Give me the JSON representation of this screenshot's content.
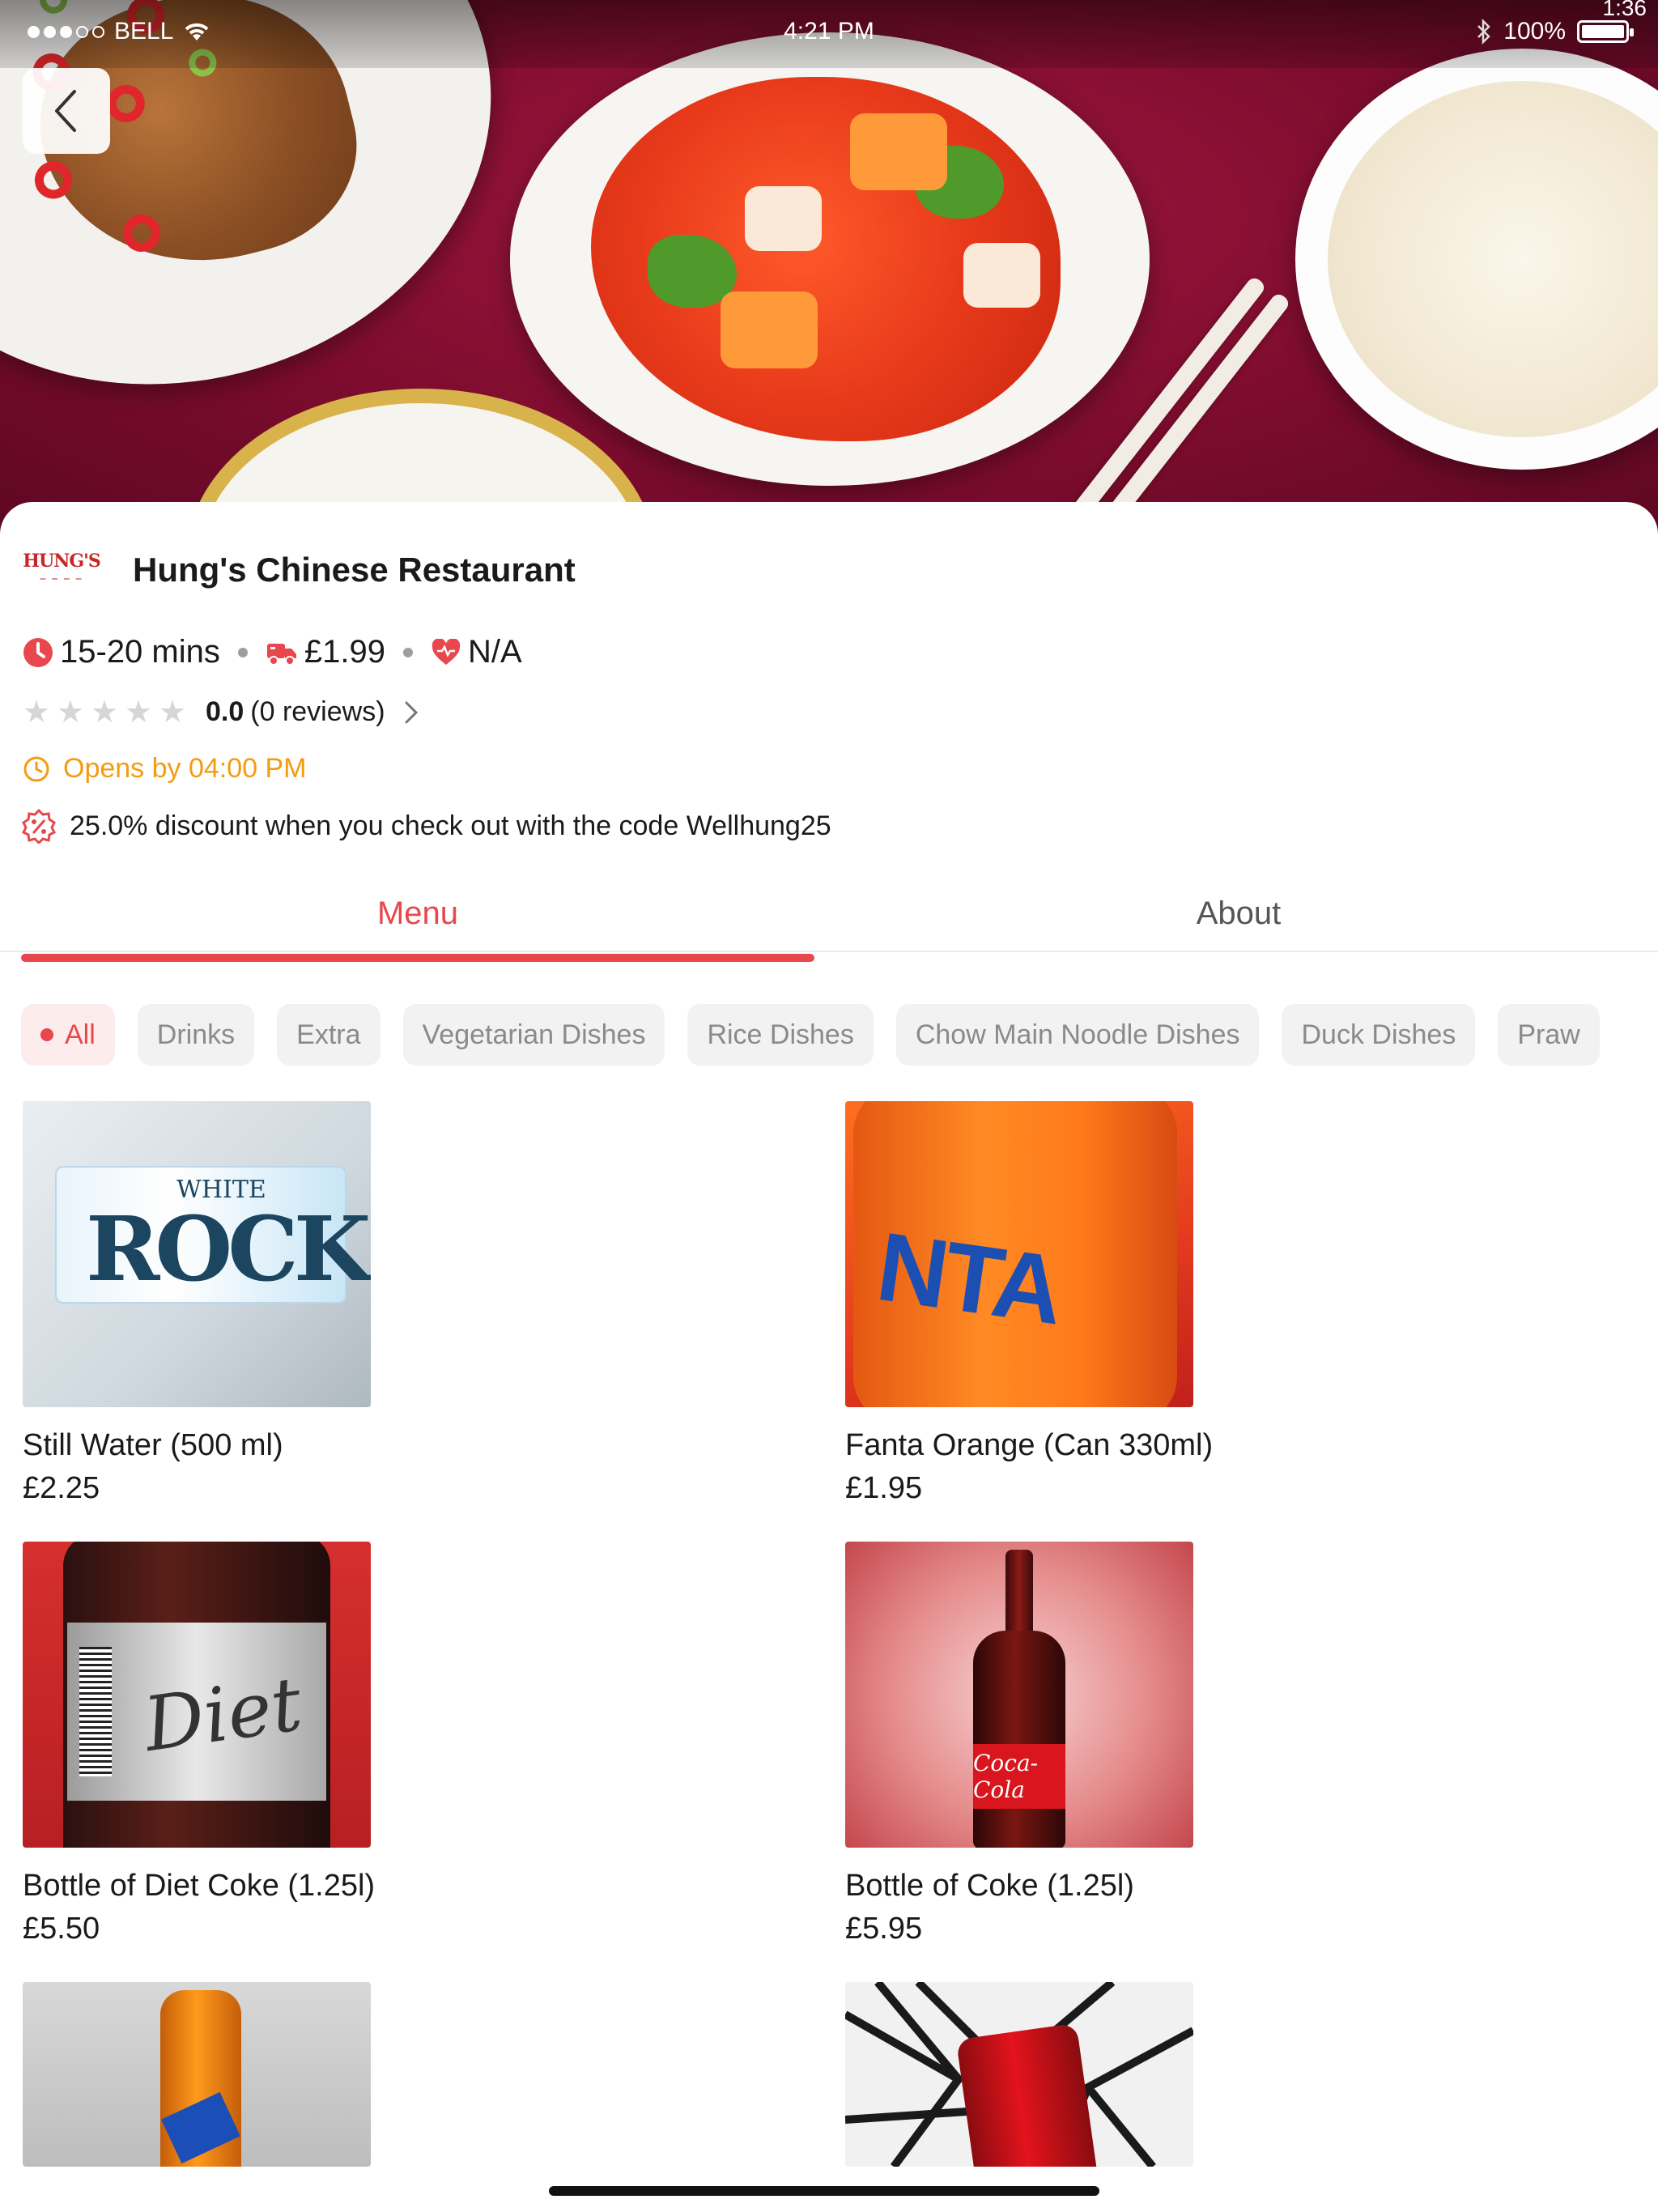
{
  "status_bar": {
    "carrier": "BELL",
    "time": "4:21 PM",
    "battery": "100%",
    "corner_time": "1:36"
  },
  "restaurant": {
    "logo_text": "HUNG'S",
    "name": "Hung's Chinese Restaurant",
    "delivery_time": "15-20 mins",
    "delivery_fee": "£1.99",
    "hygiene": "N/A",
    "rating_value": "0.0",
    "rating_reviews": "(0 reviews)",
    "opens": "Opens by 04:00 PM",
    "promo": "25.0% discount when you check out with the code Wellhung25"
  },
  "tabs": {
    "menu": "Menu",
    "about": "About"
  },
  "categories": [
    "All",
    "Drinks",
    "Extra",
    "Vegetarian Dishes",
    "Rice Dishes",
    "Chow Main Noodle Dishes",
    "Duck Dishes",
    "Praw"
  ],
  "products": [
    {
      "name": "Still Water (500 ml)",
      "price": "£2.25",
      "image_text": "ROCK",
      "image_text2": "WHITE"
    },
    {
      "name": "Fanta Orange (Can 330ml)",
      "price": "£1.95",
      "image_text": "NTA"
    },
    {
      "name": "Bottle of Diet Coke (1.25l)",
      "price": "£5.50",
      "image_text": "Diet"
    },
    {
      "name": "Bottle of Coke (1.25l)",
      "price": "£5.95",
      "image_text": "Coca-Cola"
    },
    {
      "name": "",
      "price": ""
    },
    {
      "name": "",
      "price": ""
    }
  ],
  "colors": {
    "accent": "#e8474d",
    "warning": "#f39c12",
    "hero_bg": "#7d0c2e"
  },
  "icons": {
    "back": "chevron-left-icon",
    "clock": "clock-icon",
    "delivery": "delivery-truck-icon",
    "hygiene": "heart-hygiene-icon",
    "star": "star-icon",
    "promo": "discount-badge-icon"
  }
}
